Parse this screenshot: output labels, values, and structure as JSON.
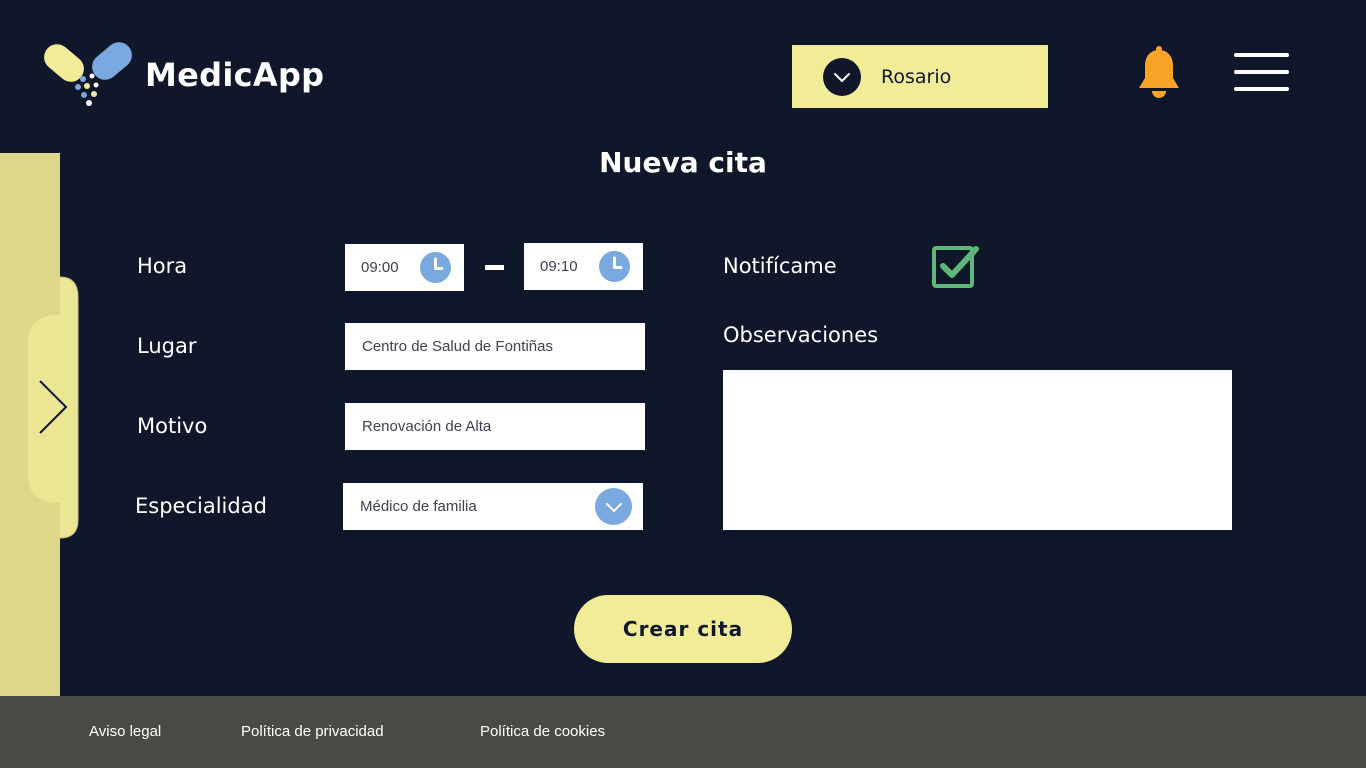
{
  "header": {
    "brand": "MedicApp",
    "user_name": "Rosario"
  },
  "page": {
    "title": "Nueva cita"
  },
  "form": {
    "hora_label": "Hora",
    "time_start": "09:00",
    "time_end": "09:10",
    "lugar_label": "Lugar",
    "lugar_value": "Centro de Salud de Fontiñas",
    "motivo_label": "Motivo",
    "motivo_value": "Renovación de Alta",
    "especialidad_label": "Especialidad",
    "especialidad_value": "Médico de familia",
    "notify_label": "Notifícame",
    "notify_checked": true,
    "observaciones_label": "Observaciones",
    "observaciones_value": "",
    "submit_label": "Crear cita"
  },
  "footer": {
    "links": [
      "Aviso legal",
      "Política de privacidad",
      "Política de cookies"
    ]
  },
  "icons": {
    "logo": "pill-capsule-logo",
    "user_toggle": "chevron-down-icon",
    "notifications": "bell-icon",
    "menu": "hamburger-menu-icon",
    "time": "clock-icon",
    "select": "chevron-down-icon",
    "checkbox": "check-icon",
    "side_panel": "chevron-right-icon"
  },
  "colors": {
    "background": "#11172a",
    "accent_yellow": "#f0ec97",
    "side_panel": "#dcd789",
    "blue": "#79a9de",
    "bell": "#f7a428",
    "check_green": "#5fb779",
    "footer": "#484b45"
  }
}
